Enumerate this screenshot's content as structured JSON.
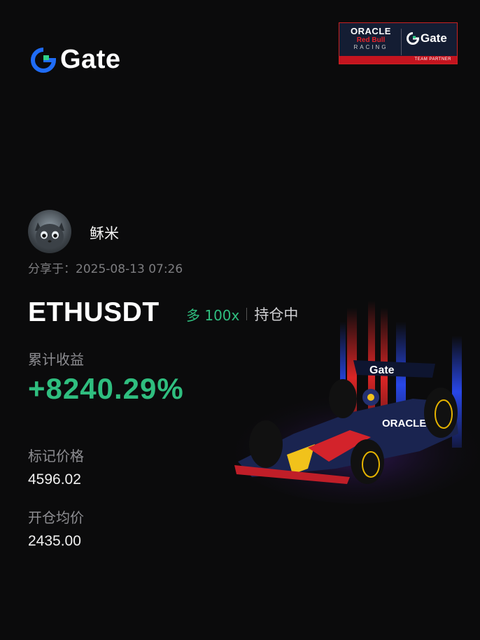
{
  "brand": {
    "name": "Gate",
    "color": "#1f6cf6",
    "icon": "gate-logo-icon"
  },
  "partner": {
    "oracle": "ORACLE",
    "red_bull": "Red Bull",
    "racing": "RACING",
    "gate": "Gate",
    "strip": "TEAM PARTNER"
  },
  "user": {
    "name": "稣米",
    "shared_label": "分享于：",
    "shared_time": "2025-08-13 07:26"
  },
  "position": {
    "pair": "ETHUSDT",
    "side": "多",
    "leverage": "100x",
    "status": "持仓中",
    "pnl_label": "累计收益",
    "pnl": "+8240.29%",
    "mark_label": "标记价格",
    "mark_price": "4596.02",
    "entry_label": "开仓均价",
    "entry_price": "2435.00"
  },
  "colors": {
    "positive": "#2fbe7f",
    "background": "#0b0b0c",
    "muted": "#8e8e92"
  }
}
